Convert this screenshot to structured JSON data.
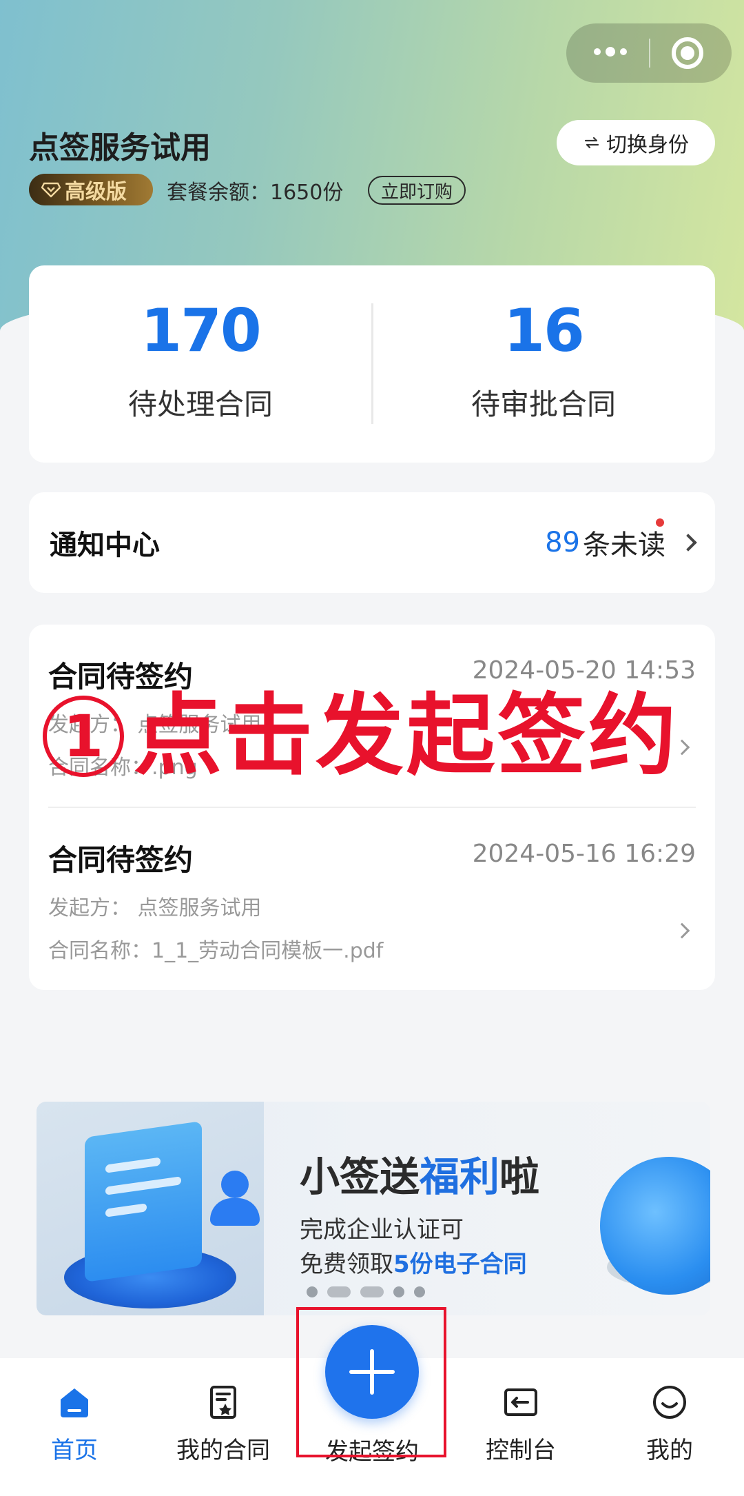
{
  "header": {
    "org_name": "点签服务试用",
    "switch_label": "切换身份",
    "badge_label": "高级版",
    "quota_text": "套餐余额：1650份",
    "order_label": "立即订购"
  },
  "stats": [
    {
      "value": "170",
      "label": "待处理合同"
    },
    {
      "value": "16",
      "label": "待审批合同"
    }
  ],
  "notice": {
    "title": "通知中心",
    "unread_count": "89",
    "unread_suffix": "条未读"
  },
  "contracts": [
    {
      "title": "合同待签约",
      "time": "2024-05-20 14:53",
      "initiator": "发起方：  点签服务试用",
      "name": "合同名称：.png"
    },
    {
      "title": "合同待签约",
      "time": "2024-05-16 16:29",
      "initiator": "发起方：  点签服务试用",
      "name": "合同名称：1_1_劳动合同模板一.pdf"
    }
  ],
  "annotation": {
    "step": "1",
    "text": "点击发起签约"
  },
  "banner": {
    "title_pre": "小签送",
    "title_hl": "福利",
    "title_post": "啦",
    "line1": "完成企业认证可",
    "line2_pre": "免费领取",
    "line2_hl": "5份电子合同"
  },
  "tabbar": {
    "items": [
      {
        "label": "首页",
        "icon": "home-icon",
        "active": true
      },
      {
        "label": "我的合同",
        "icon": "contract-icon"
      },
      {
        "label": "发起签约",
        "icon": "plus-icon"
      },
      {
        "label": "控制台",
        "icon": "console-icon"
      },
      {
        "label": "我的",
        "icon": "smiley-icon"
      }
    ]
  },
  "colors": {
    "accent": "#1a73e8",
    "annotation_red": "#e8122c"
  }
}
